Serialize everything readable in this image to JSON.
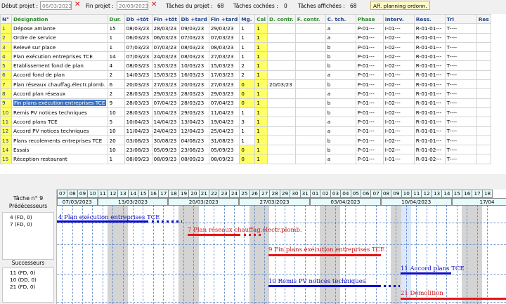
{
  "toolbar": {
    "start_label": "Début projet :",
    "start_value": "06/03/2023",
    "end_label": "Fin projet :",
    "end_value": "20/09/2023",
    "tasks_label": "Tâches du projet :",
    "tasks_value": "68",
    "checked_label": "Tâches cochées :",
    "checked_value": "0",
    "shown_label": "Tâches affichées :",
    "shown_value": "68",
    "planning_button": "Aff. planning ordonn."
  },
  "grid": {
    "headers": [
      "N°",
      "Désignation",
      "Dur.",
      "Db +tôt",
      "Fin +tôt",
      "Db +tard",
      "Fin +tard",
      "Mg.",
      "Cal",
      "D. contr.",
      "F. contr.",
      "C. tch.",
      "Phase",
      "Interv.",
      "Ress.",
      "Tri",
      "Res"
    ],
    "rows": [
      [
        "1",
        "Dépose amiante",
        "15",
        "08/03/23",
        "28/03/23",
        "09/03/23",
        "29/03/23",
        "1",
        "1",
        "",
        "",
        "a",
        "P-01---",
        "I-01---",
        "R-01-01---",
        "T----",
        ""
      ],
      [
        "2",
        "Ordre de service",
        "1",
        "06/03/23",
        "06/03/23",
        "07/03/23",
        "07/03/23",
        "1",
        "1",
        "",
        "",
        "a",
        "P-01---",
        "I-02---",
        "R-01-01---",
        "T----",
        ""
      ],
      [
        "3",
        "Relevé sur place",
        "1",
        "07/03/23",
        "07/03/23",
        "08/03/23",
        "08/03/23",
        "1",
        "1",
        "",
        "",
        "b",
        "P-01---",
        "I-02---",
        "R-01-01---",
        "T----",
        ""
      ],
      [
        "4",
        "Plan exécution entreprises TCE",
        "14",
        "07/03/23",
        "24/03/23",
        "08/03/23",
        "27/03/23",
        "1",
        "1",
        "",
        "",
        "b",
        "P-01---",
        "I-02---",
        "R-01-01---",
        "T----",
        ""
      ],
      [
        "5",
        "Etablissement fond de plan",
        "4",
        "08/03/23",
        "13/03/23",
        "10/03/23",
        "15/03/23",
        "2",
        "1",
        "",
        "",
        "b",
        "P-01---",
        "I-02---",
        "R-01-01---",
        "T----",
        ""
      ],
      [
        "6",
        "Accord fond de plan",
        "2",
        "14/03/23",
        "15/03/23",
        "16/03/23",
        "17/03/23",
        "2",
        "1",
        "",
        "",
        "a",
        "P-01---",
        "I-01---",
        "R-01-01---",
        "T----",
        ""
      ],
      [
        "7",
        "Plan réseaux chauffag.électr.plomb.",
        "6",
        "20/03/23",
        "27/03/23",
        "20/03/23",
        "27/03/23",
        "0",
        "1",
        "20/03/23",
        "",
        "b",
        "P-01---",
        "I-02---",
        "R-01-01---",
        "T----",
        ""
      ],
      [
        "8",
        "Accord plan réseaux",
        "2",
        "28/03/23",
        "29/03/23",
        "28/03/23",
        "29/03/23",
        "0",
        "1",
        "",
        "",
        "a",
        "P-01---",
        "I-01---",
        "R-01-01---",
        "T----",
        ""
      ],
      [
        "9",
        "Fin plans exécution entreprises TCE",
        "9",
        "28/03/23",
        "07/04/23",
        "28/03/23",
        "07/04/23",
        "0",
        "1",
        "",
        "",
        "b",
        "P-01---",
        "I-02---",
        "R-01-01---",
        "T----",
        ""
      ],
      [
        "10",
        "Remis PV notices techniques",
        "10",
        "28/03/23",
        "10/04/23",
        "29/03/23",
        "11/04/23",
        "1",
        "1",
        "",
        "",
        "b",
        "P-01---",
        "I-02---",
        "R-01-01---",
        "T----",
        ""
      ],
      [
        "11",
        "Accord plans TCE",
        "5",
        "10/04/23",
        "14/04/23",
        "13/04/23",
        "19/04/23",
        "3",
        "1",
        "",
        "",
        "a",
        "P-01---",
        "I-01---",
        "R-01-01---",
        "T----",
        ""
      ],
      [
        "12",
        "Accord PV notices techniques",
        "10",
        "11/04/23",
        "24/04/23",
        "12/04/23",
        "25/04/23",
        "1",
        "1",
        "",
        "",
        "a",
        "P-01---",
        "I-01---",
        "R-01-01---",
        "T----",
        ""
      ],
      [
        "13",
        "Plans recolements entreprises TCE",
        "20",
        "03/08/23",
        "30/08/23",
        "04/08/23",
        "31/08/23",
        "1",
        "1",
        "",
        "",
        "b",
        "P-01---",
        "I-02---",
        "R-01-01---",
        "T----",
        ""
      ],
      [
        "14",
        "Essais",
        "10",
        "23/08/23",
        "05/09/23",
        "23/08/23",
        "05/09/23",
        "0",
        "1",
        "",
        "",
        "b",
        "P-01---",
        "I-02---",
        "R-01-02---",
        "T----",
        ""
      ],
      [
        "15",
        "Réception restaurant",
        "1",
        "08/09/23",
        "08/09/23",
        "08/09/23",
        "08/09/23",
        "0",
        "1",
        "",
        "",
        "a",
        "P-01---",
        "I-01---",
        "R-01-02---",
        "T----",
        ""
      ]
    ]
  },
  "left_panel": {
    "task_title": "Tâche n° 9",
    "predecessors_title": "Prédécesseurs",
    "predecessors": [
      "4  (FD, 0)",
      "7  (FD, 0)"
    ],
    "successors_title": "Successeurs",
    "successors": [
      "11  (FD, 0)",
      "10  (DD, 0)",
      "21  (FD, 0)"
    ]
  },
  "gantt": {
    "days": [
      "07",
      "08",
      "09",
      "10",
      "11",
      "12",
      "13",
      "14",
      "15",
      "16",
      "17",
      "18",
      "19",
      "20",
      "21",
      "22",
      "23",
      "24",
      "25",
      "26",
      "27",
      "28",
      "29",
      "30",
      "31",
      "01",
      "02",
      "03",
      "04",
      "05",
      "06",
      "07",
      "08",
      "09",
      "10",
      "11",
      "12",
      "13",
      "14",
      "15",
      "16",
      "17",
      "18"
    ],
    "weeks": [
      "07/03/2023",
      "13/03/2023",
      "20/03/2023",
      "27/03/2023",
      "03/04/2023",
      "10/04/2023",
      "17/04"
    ],
    "tasks": [
      {
        "label": "4 Plan exécution entreprises TCE",
        "color": "blue"
      },
      {
        "label": "7 Plan réseaux chauffag.électr.plomb.",
        "color": "red"
      },
      {
        "label": "9 Fin plans exécution entreprises TCE",
        "color": "red"
      },
      {
        "label": "11 Accord plans TCE",
        "color": "blue"
      },
      {
        "label": "10 Remis PV notices techniques",
        "color": "blue"
      },
      {
        "label": "21 Démolition",
        "color": "red"
      }
    ]
  }
}
